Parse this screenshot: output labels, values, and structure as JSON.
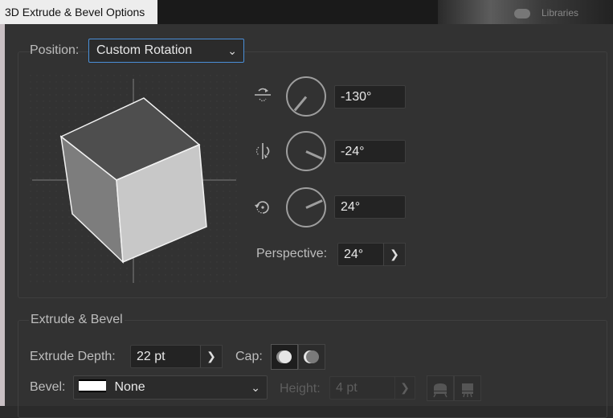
{
  "window": {
    "title": "3D Extrude & Bevel Options"
  },
  "background": {
    "libraries_label": "Libraries"
  },
  "position": {
    "label": "Position:",
    "value": "Custom Rotation"
  },
  "rotation": {
    "x_angle": "-130°",
    "y_angle": "-24°",
    "z_angle": "24°",
    "perspective_label": "Perspective:",
    "perspective_value": "24°"
  },
  "extrude": {
    "section_title": "Extrude & Bevel",
    "depth_label": "Extrude Depth:",
    "depth_value": "22 pt",
    "cap_label": "Cap:",
    "bevel_label": "Bevel:",
    "bevel_value": "None",
    "height_label": "Height:",
    "height_value": "4 pt"
  },
  "icons": {
    "x_axis": "rotate-x-icon",
    "y_axis": "rotate-y-icon",
    "z_axis": "rotate-z-icon",
    "cap_on": "cap-on-icon",
    "cap_off": "cap-off-icon",
    "bevel_out": "bevel-out-icon",
    "bevel_in": "bevel-in-icon"
  },
  "colors": {
    "focus": "#4a8fd8",
    "panel": "#323232"
  }
}
